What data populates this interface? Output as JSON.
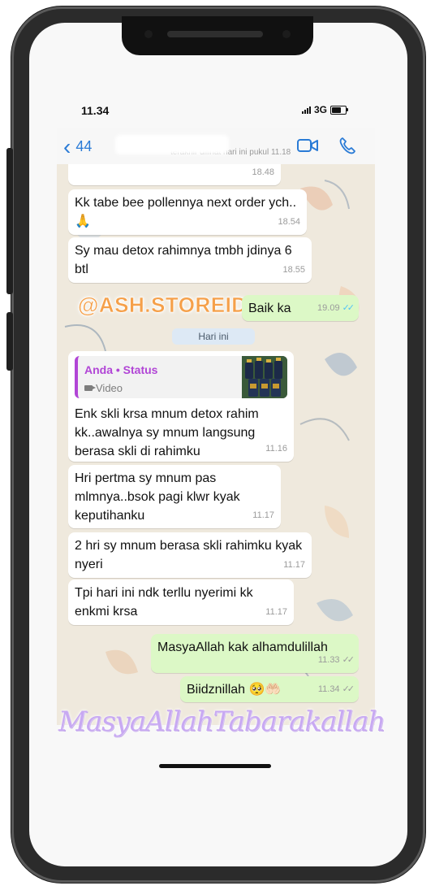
{
  "status_bar": {
    "time": "11.34",
    "network": "3G"
  },
  "header": {
    "back_count": "44",
    "last_seen": "terakhir dilihat hari ini pukul 11.18"
  },
  "watermarks": {
    "store_handle": "@ASH.STOREID",
    "script_text": "MasyaAllahTabarakallah"
  },
  "date_divider": "Hari ini",
  "messages": [
    {
      "dir": "in",
      "text": "",
      "time": "18.48"
    },
    {
      "dir": "in",
      "text": "Kk tabe bee pollennya next order ych..🙏",
      "time": "18.54"
    },
    {
      "dir": "in",
      "text": "Sy mau detox rahimnya tmbh jdinya 6 btl",
      "time": "18.55"
    },
    {
      "dir": "out",
      "text": "Baik ka",
      "time": "19.09"
    },
    {
      "dir": "in",
      "reply_name": "Anda • Status",
      "reply_type": "Video",
      "text": "Enk skli krsa mnum detox rahim kk..awalnya sy mnum langsung berasa skli di rahimku",
      "time": "11.16"
    },
    {
      "dir": "in",
      "text": "Hri pertma sy mnum pas mlmnya..bsok pagi klwr kyak keputihanku",
      "time": "11.17"
    },
    {
      "dir": "in",
      "text": "2 hri sy mnum berasa skli rahimku kyak nyeri",
      "time": "11.17"
    },
    {
      "dir": "in",
      "text": "Tpi hari ini ndk terllu nyerimi kk enkmi krsa",
      "time": "11.17"
    },
    {
      "dir": "out",
      "text": "MasyaAllah kak alhamdulillah",
      "time": "11.33"
    },
    {
      "dir": "out",
      "text": "Biidznillah 🥺🤲🏻",
      "time": "11.34"
    }
  ],
  "colors": {
    "accent": "#2a7bd6",
    "outgoing": "#dcf8c6",
    "incoming": "#ffffff",
    "status_name": "#b145d6"
  }
}
